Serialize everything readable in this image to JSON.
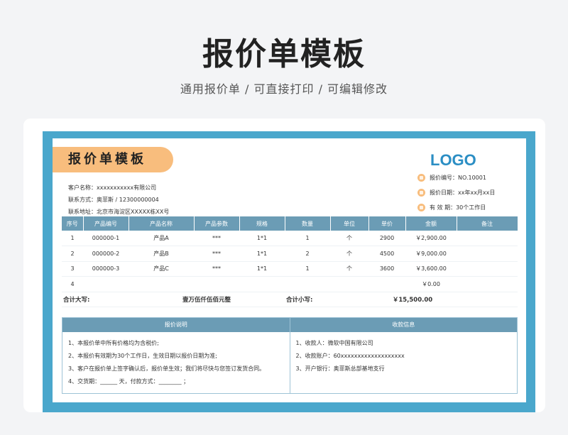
{
  "hero": {
    "title": "报价单模板",
    "subtitle": "通用报价单  / 可直接打印 /  可编辑修改"
  },
  "doc": {
    "title": "报价单模板",
    "logo": "LOGO",
    "customer": [
      "客户名称：xxxxxxxxxxx有限公司",
      "联系方式：奥菲斯 / 12300000004",
      "联系地址：北京市海淀区XXXXX栋XX号"
    ],
    "meta": [
      "报价编号：NO.10001",
      "报价日期：xx年xx月xx日",
      "有 效 期：30个工作日"
    ]
  },
  "table": {
    "headers": [
      "序号",
      "产品编号",
      "产品名称",
      "产品参数",
      "规格",
      "数量",
      "单位",
      "单价",
      "金额",
      "备注"
    ],
    "rows": [
      [
        "1",
        "000000-1",
        "产品A",
        "***",
        "1*1",
        "1",
        "个",
        "2900",
        "￥2,900.00",
        ""
      ],
      [
        "2",
        "000000-2",
        "产品B",
        "***",
        "1*1",
        "2",
        "个",
        "4500",
        "￥9,000.00",
        ""
      ],
      [
        "3",
        "000000-3",
        "产品C",
        "***",
        "1*1",
        "1",
        "个",
        "3600",
        "￥3,600.00",
        ""
      ],
      [
        "4",
        "",
        "",
        "",
        "",
        "",
        "",
        "",
        "￥0.00",
        ""
      ]
    ],
    "total_upper_label": "合计大写:",
    "total_upper_value": "壹万伍仟伍佰元整",
    "total_lower_label": "合计小写:",
    "total_lower_value": "￥15,500.00"
  },
  "notes": {
    "left_title": "报价说明",
    "left_lines": [
      "1、本报价单中所有价格均为含税价;",
      "2、本报价有效期为30个工作日，生效日期以报价日期为准;",
      "3、客户在报价单上签字确认后，报价单生效；我们将尽快与您签订发货合同。",
      "4、交货期：______ 天，付款方式：________ ；"
    ],
    "right_title": "收款信息",
    "right_lines": [
      "1、收款人：微软中国有限公司",
      "2、收款账户：60xxxxxxxxxxxxxxxxxxx",
      "3、开户银行：奥菲斯总部基地支行"
    ]
  }
}
